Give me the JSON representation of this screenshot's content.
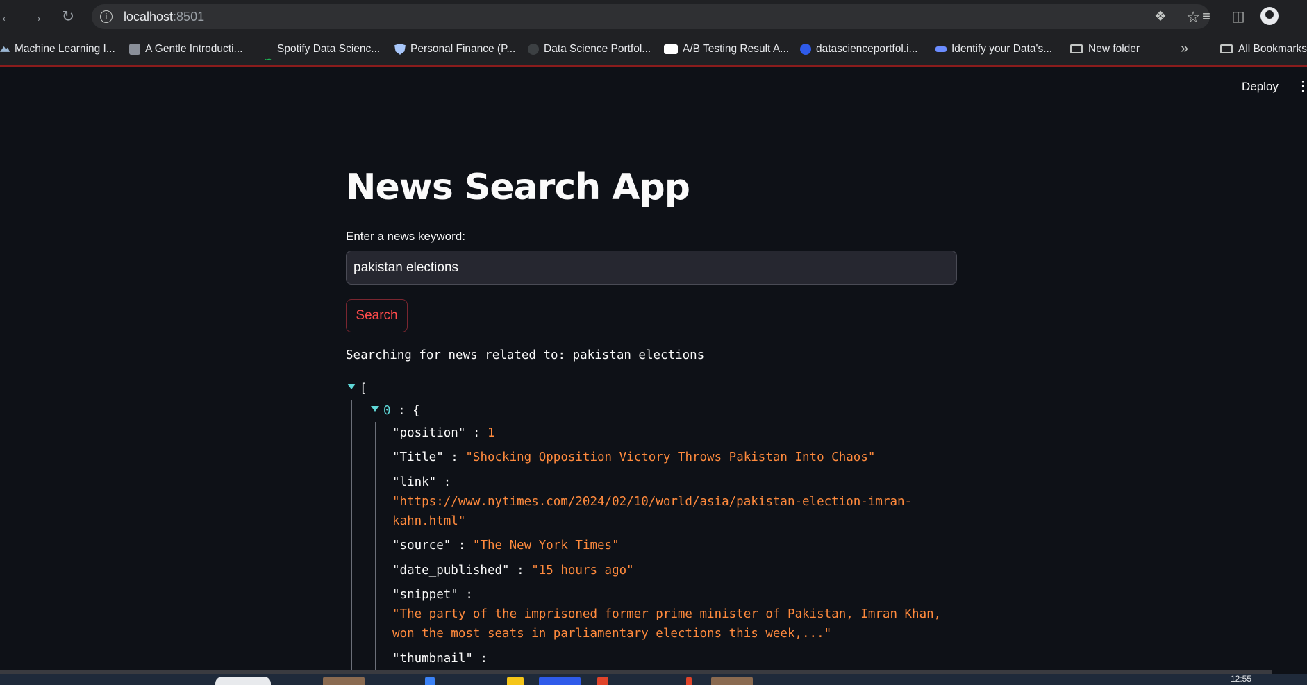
{
  "browser": {
    "url_host": "localhost",
    "url_port": ":8501",
    "bookmarks": [
      {
        "label": "Machine Learning I...",
        "icon": "mountain-icon",
        "color": "#9bb7d4"
      },
      {
        "label": "A Gentle Introducti...",
        "icon": "page-icon",
        "color": "#8a8f99"
      },
      {
        "label": "Spotify Data Scienc...",
        "icon": "spotify-icon",
        "color": "#1db954"
      },
      {
        "label": "Personal Finance (P...",
        "icon": "shield-icon",
        "color": "#a8c7fa"
      },
      {
        "label": "Data Science Portfol...",
        "icon": "globe-icon",
        "color": "#3c4043"
      },
      {
        "label": "A/B Testing Result A...",
        "icon": "medium-icon",
        "color": "#ffffff"
      },
      {
        "label": "datascienceportfol.i...",
        "icon": "d-icon",
        "color": "#2f5bea"
      },
      {
        "label": "Identify your Data's...",
        "icon": "tds-icon",
        "color": "#6b8cff"
      },
      {
        "label": "New folder",
        "icon": "folder-icon",
        "color": "#c4c7c5"
      }
    ],
    "all_bookmarks": "All Bookmarks"
  },
  "app": {
    "deploy_label": "Deploy",
    "title": "News Search App",
    "input_label": "Enter a news keyword:",
    "input_value": "pakistan elections",
    "search_button": "Search",
    "status_text": "Searching for news related to: pakistan elections"
  },
  "json_view": {
    "open_bracket": "[",
    "item_index": "0",
    "item_open": "{",
    "fields": {
      "position_key": "\"position\"",
      "position_val": "1",
      "title_key": "\"Title\"",
      "title_val": "\"Shocking Opposition Victory Throws Pakistan Into Chaos\"",
      "link_key": "\"link\"",
      "link_val_1": "\"https://www.nytimes.com/2024/02/10/world/asia/pakistan-election-imran-",
      "link_val_2": "kahn.html\"",
      "source_key": "\"source\"",
      "source_val": "\"The New York Times\"",
      "date_key": "\"date_published\"",
      "date_val": "\"15 hours ago\"",
      "snippet_key": "\"snippet\"",
      "snippet_val_1": "\"The party of the imprisoned former prime minister of Pakistan, Imran Khan,",
      "snippet_val_2": "won the most seats in parliamentary elections this week,...\"",
      "thumbnail_key": "\"thumbnail\""
    }
  },
  "taskbar": {
    "clock": "12:55"
  }
}
